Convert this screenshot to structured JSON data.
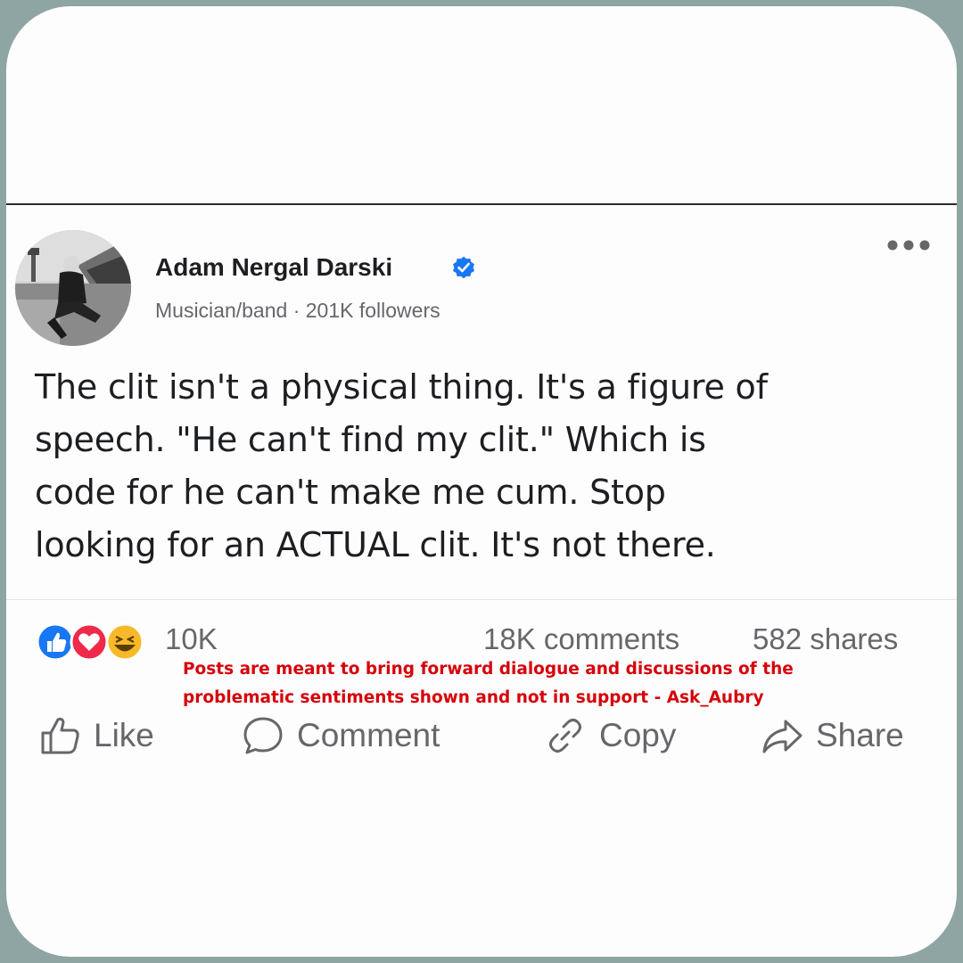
{
  "post": {
    "author": {
      "name": "Adam Nergal Darski",
      "verified": true,
      "meta": "Musician/band · 201K followers",
      "avatar": "profile-photo"
    },
    "text": "The clit isn't a physical thing. It's a figure of\nspeech. \"He can't find my clit.\" Which is\ncode for he can't make me cum.  Stop\nlooking for an ACTUAL clit. It's not there.",
    "menu_icon": "more-horizontal-icon"
  },
  "stats": {
    "reactions": [
      "like",
      "love",
      "haha"
    ],
    "reaction_count": "10K",
    "comments": "18K comments",
    "shares": "582 shares"
  },
  "disclaimer": "Posts are meant to bring forward dialogue and discussions of the\nproblematic sentiments shown and not in support - Ask_Aubry",
  "actions": {
    "like": "Like",
    "comment": "Comment",
    "copy": "Copy",
    "share": "Share"
  },
  "colors": {
    "background": "#8fa5a3",
    "card": "#fdfdfd",
    "verified": "#1877f2",
    "disclaimer": "#d6000a",
    "muted_text": "#65676b"
  }
}
